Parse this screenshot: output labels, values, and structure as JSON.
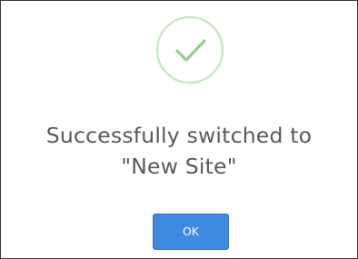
{
  "dialog": {
    "icon": "checkmark-circle-icon",
    "accent_color": "#a9dca9",
    "message_line1": "Successfully switched to",
    "message_line2": "\"New Site\"",
    "ok_label": "OK",
    "button_color": "#3d8ae0"
  }
}
